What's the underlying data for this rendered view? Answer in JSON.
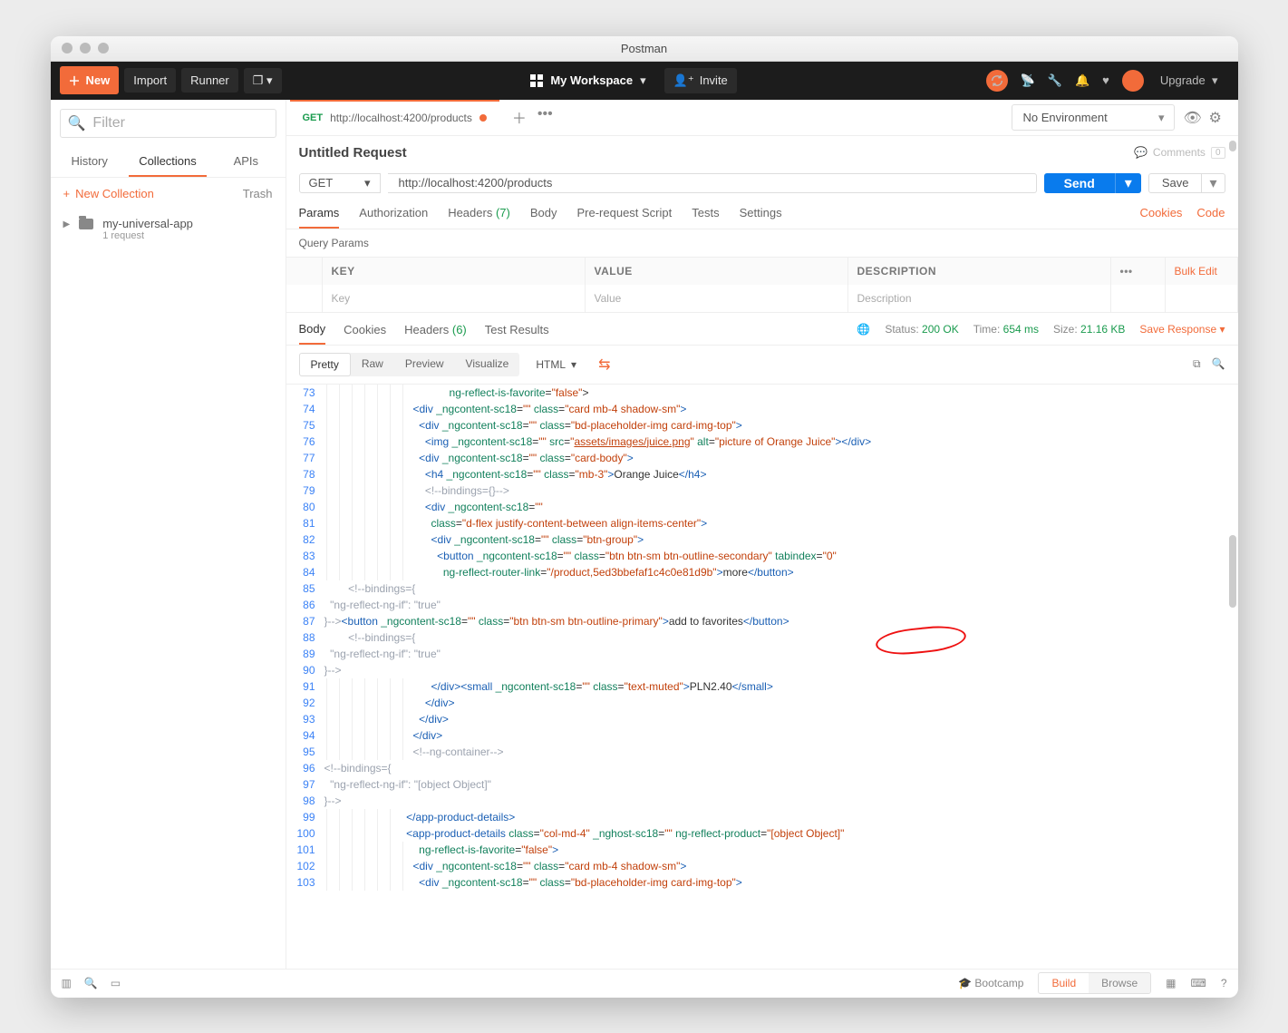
{
  "app": {
    "title": "Postman"
  },
  "topbar": {
    "new": "New",
    "import": "Import",
    "runner": "Runner",
    "workspace": "My Workspace",
    "invite": "Invite",
    "upgrade": "Upgrade"
  },
  "sidebar": {
    "filter_placeholder": "Filter",
    "tabs": {
      "history": "History",
      "collections": "Collections",
      "apis": "APIs"
    },
    "new_collection": "New Collection",
    "trash": "Trash",
    "collection": {
      "name": "my-universal-app",
      "sub": "1 request"
    }
  },
  "tabs": {
    "method": "GET",
    "url": "http://localhost:4200/products",
    "env_label": "No Environment"
  },
  "request": {
    "name": "Untitled Request",
    "comments_label": "Comments",
    "comments_count": "0",
    "method": "GET",
    "url": "http://localhost:4200/products",
    "send": "Send",
    "save": "Save",
    "subtabs": {
      "params": "Params",
      "auth": "Authorization",
      "headers": "Headers",
      "headers_count": "(7)",
      "body": "Body",
      "prs": "Pre-request Script",
      "tests": "Tests",
      "settings": "Settings",
      "cookies": "Cookies",
      "code": "Code"
    },
    "qp_title": "Query Params",
    "ptable": {
      "key_h": "KEY",
      "value_h": "VALUE",
      "desc_h": "DESCRIPTION",
      "bulk": "Bulk Edit",
      "key_p": "Key",
      "value_p": "Value",
      "desc_p": "Description"
    }
  },
  "response": {
    "tabs": {
      "body": "Body",
      "cookies": "Cookies",
      "headers": "Headers",
      "headers_count": "(6)",
      "tests": "Test Results"
    },
    "meta": {
      "status_l": "Status:",
      "status_v": "200 OK",
      "time_l": "Time:",
      "time_v": "654 ms",
      "size_l": "Size:",
      "size_v": "21.16 KB",
      "save": "Save Response"
    },
    "view": {
      "pretty": "Pretty",
      "raw": "Raw",
      "preview": "Preview",
      "visualize": "Visualize",
      "lang": "HTML"
    }
  },
  "code": [
    {
      "n": 73,
      "i": 7,
      "h": "            <span class='t-attr'>ng-reflect-is-favorite</span>=<span class='t-str'>\"false\"</span>&gt;"
    },
    {
      "n": 74,
      "i": 7,
      "h": "<span class='t-tag'>&lt;div</span> <span class='t-attr'>_ngcontent-sc18</span>=<span class='t-str'>\"\"</span> <span class='t-attr'>class</span>=<span class='t-str'>\"card mb-4 shadow-sm\"</span><span class='t-tag'>&gt;</span>"
    },
    {
      "n": 75,
      "i": 7,
      "h": "  <span class='t-tag'>&lt;div</span> <span class='t-attr'>_ngcontent-sc18</span>=<span class='t-str'>\"\"</span> <span class='t-attr'>class</span>=<span class='t-str'>\"bd-placeholder-img card-img-top\"</span><span class='t-tag'>&gt;</span>"
    },
    {
      "n": 76,
      "i": 7,
      "h": "    <span class='t-tag'>&lt;img</span> <span class='t-attr'>_ngcontent-sc18</span>=<span class='t-str'>\"\"</span> <span class='t-attr'>src</span>=<span class='t-str'>\"<u>assets/images/juice.png</u>\"</span> <span class='t-attr'>alt</span>=<span class='t-str'>\"picture of Orange Juice\"</span><span class='t-tag'>&gt;&lt;/div&gt;</span>"
    },
    {
      "n": 77,
      "i": 7,
      "h": "  <span class='t-tag'>&lt;div</span> <span class='t-attr'>_ngcontent-sc18</span>=<span class='t-str'>\"\"</span> <span class='t-attr'>class</span>=<span class='t-str'>\"card-body\"</span><span class='t-tag'>&gt;</span>"
    },
    {
      "n": 78,
      "i": 7,
      "h": "    <span class='t-tag'>&lt;h4</span> <span class='t-attr'>_ngcontent-sc18</span>=<span class='t-str'>\"\"</span> <span class='t-attr'>class</span>=<span class='t-str'>\"mb-3\"</span><span class='t-tag'>&gt;</span>Orange Juice<span class='t-tag'>&lt;/h4&gt;</span>"
    },
    {
      "n": 79,
      "i": 7,
      "h": "    <span class='t-cmt'>&lt;!--bindings={}--&gt;</span>"
    },
    {
      "n": 80,
      "i": 7,
      "h": "    <span class='t-tag'>&lt;div</span> <span class='t-attr'>_ngcontent-sc18</span>=<span class='t-str'>\"\"</span>"
    },
    {
      "n": 81,
      "i": 7,
      "h": "      <span class='t-attr'>class</span>=<span class='t-str'>\"d-flex justify-content-between align-items-center\"</span><span class='t-tag'>&gt;</span>"
    },
    {
      "n": 82,
      "i": 7,
      "h": "      <span class='t-tag'>&lt;div</span> <span class='t-attr'>_ngcontent-sc18</span>=<span class='t-str'>\"\"</span> <span class='t-attr'>class</span>=<span class='t-str'>\"btn-group\"</span><span class='t-tag'>&gt;</span>"
    },
    {
      "n": 83,
      "i": 7,
      "h": "        <span class='t-tag'>&lt;button</span> <span class='t-attr'>_ngcontent-sc18</span>=<span class='t-str'>\"\"</span> <span class='t-attr'>class</span>=<span class='t-str'>\"btn btn-sm btn-outline-secondary\"</span> <span class='t-attr'>tabindex</span>=<span class='t-str'>\"0\"</span>"
    },
    {
      "n": 84,
      "i": 7,
      "h": "          <span class='t-attr'>ng-reflect-router-link</span>=<span class='t-str'>\"/product,5ed3bbefaf1c4c0e81d9b\"</span><span class='t-tag'>&gt;</span>more<span class='t-tag'>&lt;/button&gt;</span>"
    },
    {
      "n": 85,
      "i": 0,
      "h": "        <span class='t-cmt'>&lt;!--bindings={</span>"
    },
    {
      "n": 86,
      "i": 0,
      "h": "<span class='t-cmt'>  \"ng-reflect-ng-if\": \"true\"</span>"
    },
    {
      "n": 87,
      "i": 0,
      "h": "<span class='t-cmt'>}--&gt;</span><span class='t-tag'>&lt;button</span> <span class='t-attr'>_ngcontent-sc18</span>=<span class='t-str'>\"\"</span> <span class='t-attr'>class</span>=<span class='t-str'>\"btn btn-sm btn-outline-primary\"</span><span class='t-tag'>&gt;</span>add to favorites<span class='t-tag'>&lt;/button&gt;</span>"
    },
    {
      "n": 88,
      "i": 0,
      "h": "        <span class='t-cmt'>&lt;!--bindings={</span>"
    },
    {
      "n": 89,
      "i": 0,
      "h": "<span class='t-cmt'>  \"ng-reflect-ng-if\": \"true\"</span>"
    },
    {
      "n": 90,
      "i": 0,
      "h": "<span class='t-cmt'>}--&gt;</span>"
    },
    {
      "n": 91,
      "i": 7,
      "h": "      <span class='t-tag'>&lt;/div&gt;</span><span class='t-tag'>&lt;small</span> <span class='t-attr'>_ngcontent-sc18</span>=<span class='t-str'>\"\"</span> <span class='t-attr'>class</span>=<span class='t-str'>\"text-muted\"</span><span class='t-tag'>&gt;</span>PLN2.40<span class='t-tag'>&lt;/small&gt;</span>"
    },
    {
      "n": 92,
      "i": 7,
      "h": "    <span class='t-tag'>&lt;/div&gt;</span>"
    },
    {
      "n": 93,
      "i": 7,
      "h": "  <span class='t-tag'>&lt;/div&gt;</span>"
    },
    {
      "n": 94,
      "i": 7,
      "h": "<span class='t-tag'>&lt;/div&gt;</span>"
    },
    {
      "n": 95,
      "i": 7,
      "h": "<span class='t-cmt'>&lt;!--ng-container--&gt;</span>"
    },
    {
      "n": 96,
      "i": 0,
      "h": "<span class='t-cmt'>&lt;!--bindings={</span>"
    },
    {
      "n": 97,
      "i": 0,
      "h": "<span class='t-cmt'>  \"ng-reflect-ng-if\": \"[object Object]\"</span>"
    },
    {
      "n": 98,
      "i": 0,
      "h": "<span class='t-cmt'>}--&gt;</span>"
    },
    {
      "n": 99,
      "i": 6,
      "h": "  <span class='t-tag'>&lt;/app-product-details&gt;</span>"
    },
    {
      "n": 100,
      "i": 6,
      "h": "  <span class='t-tag'>&lt;app-product-details</span> <span class='t-attr'>class</span>=<span class='t-str'>\"col-md-4\"</span> <span class='t-attr'>_nghost-sc18</span>=<span class='t-str'>\"\"</span> <span class='t-attr'>ng-reflect-product</span>=<span class='t-str'>\"[object Object]\"</span>"
    },
    {
      "n": 101,
      "i": 7,
      "h": "  <span class='t-attr'>ng-reflect-is-favorite</span>=<span class='t-str'>\"false\"</span><span class='t-tag'>&gt;</span>"
    },
    {
      "n": 102,
      "i": 7,
      "h": "<span class='t-tag'>&lt;div</span> <span class='t-attr'>_ngcontent-sc18</span>=<span class='t-str'>\"\"</span> <span class='t-attr'>class</span>=<span class='t-str'>\"card mb-4 shadow-sm\"</span><span class='t-tag'>&gt;</span>"
    },
    {
      "n": 103,
      "i": 7,
      "h": "  <span class='t-tag'>&lt;div</span> <span class='t-attr'>_ngcontent-sc18</span>=<span class='t-str'>\"\"</span> <span class='t-attr'>class</span>=<span class='t-str'>\"bd-placeholder-img card-img-top\"</span><span class='t-tag'>&gt;</span>"
    }
  ],
  "footer": {
    "bootcamp": "Bootcamp",
    "build": "Build",
    "browse": "Browse"
  }
}
